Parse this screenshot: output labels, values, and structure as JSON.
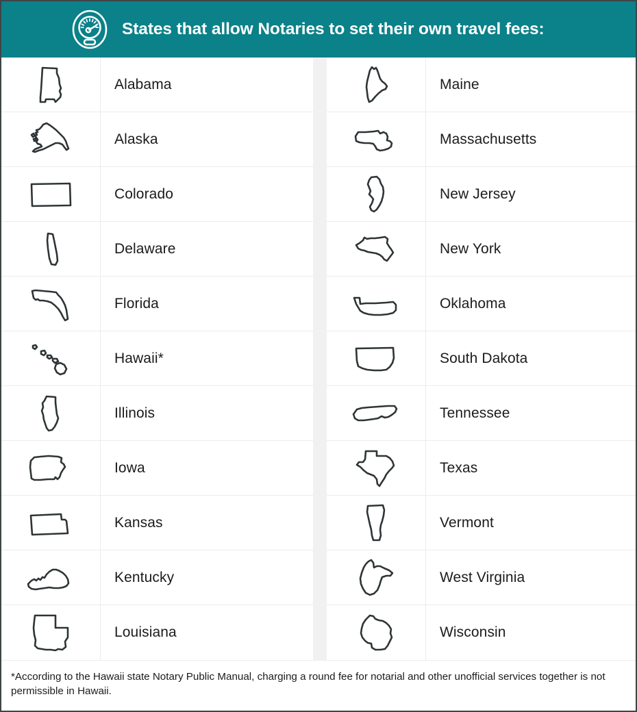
{
  "header": {
    "icon": "speedometer-gauge-icon",
    "title": "States that allow Notaries to set their own travel fees:",
    "background_color": "#0b8189",
    "text_color": "#ffffff"
  },
  "table": {
    "left_column": [
      {
        "icon": "alabama-outline-icon",
        "name": "Alabama"
      },
      {
        "icon": "alaska-outline-icon",
        "name": "Alaska"
      },
      {
        "icon": "colorado-outline-icon",
        "name": "Colorado"
      },
      {
        "icon": "delaware-outline-icon",
        "name": "Delaware"
      },
      {
        "icon": "florida-outline-icon",
        "name": "Florida"
      },
      {
        "icon": "hawaii-outline-icon",
        "name": "Hawaii*"
      },
      {
        "icon": "illinois-outline-icon",
        "name": "Illinois"
      },
      {
        "icon": "iowa-outline-icon",
        "name": "Iowa"
      },
      {
        "icon": "kansas-outline-icon",
        "name": "Kansas"
      },
      {
        "icon": "kentucky-outline-icon",
        "name": "Kentucky"
      },
      {
        "icon": "louisiana-outline-icon",
        "name": "Louisiana"
      }
    ],
    "right_column": [
      {
        "icon": "maine-outline-icon",
        "name": "Maine"
      },
      {
        "icon": "massachusetts-outline-icon",
        "name": "Massachusetts"
      },
      {
        "icon": "new-jersey-outline-icon",
        "name": "New Jersey"
      },
      {
        "icon": "new-york-outline-icon",
        "name": "New York"
      },
      {
        "icon": "oklahoma-outline-icon",
        "name": "Oklahoma"
      },
      {
        "icon": "south-dakota-outline-icon",
        "name": "South Dakota"
      },
      {
        "icon": "tennessee-outline-icon",
        "name": "Tennessee"
      },
      {
        "icon": "texas-outline-icon",
        "name": "Texas"
      },
      {
        "icon": "vermont-outline-icon",
        "name": "Vermont"
      },
      {
        "icon": "west-virginia-outline-icon",
        "name": "West Virginia"
      },
      {
        "icon": "wisconsin-outline-icon",
        "name": "Wisconsin"
      }
    ]
  },
  "footnote": {
    "text": "*According to the Hawaii state Notary Public Manual, charging a round fee for notarial and other unofficial services together is not permissible in Hawaii."
  },
  "colors": {
    "accent_teal": "#0b8189",
    "outline_stroke": "#2e3436",
    "divider": "#ececec",
    "gap_column": "#f1f1f1",
    "page_border": "#3f4547"
  }
}
